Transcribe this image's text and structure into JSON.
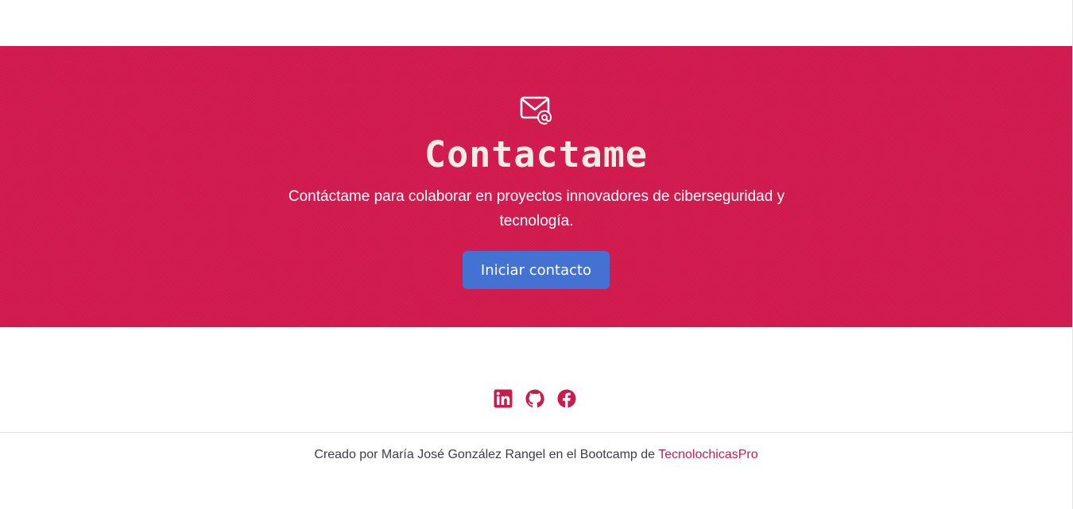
{
  "contact": {
    "icon": "mail-at-icon",
    "title": "Contactame",
    "text": "Contáctame para colaborar en proyectos innovadores de ciberseguridad y tecnología.",
    "button_label": "Iniciar contacto",
    "background_color": "#d31a4e",
    "button_color": "#4472d2"
  },
  "social": {
    "icons": [
      "linkedin-icon",
      "github-icon",
      "facebook-icon"
    ],
    "icon_color": "#c81c4c"
  },
  "footer": {
    "text": "Creado por María José González Rangel en el Bootcamp de ",
    "link_text": "TecnolochicasPro",
    "link_color": "#c81c4c"
  }
}
